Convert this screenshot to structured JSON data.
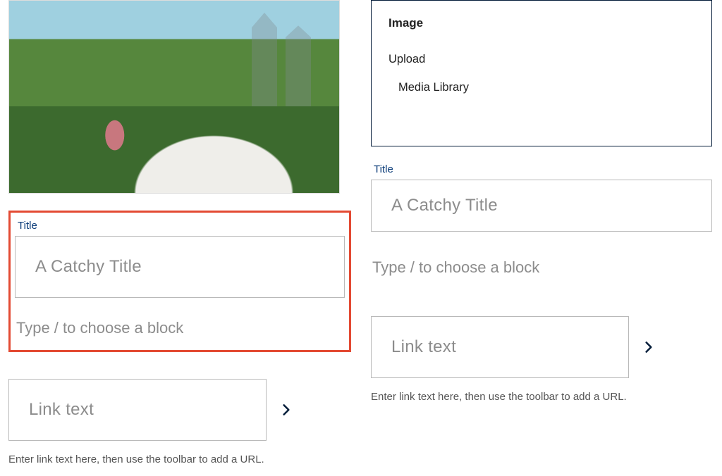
{
  "left": {
    "title_label": "Title",
    "title_placeholder": "A Catchy Title",
    "block_hint": "Type / to choose a block",
    "link_placeholder": "Link text",
    "link_helper": "Enter link text here, then use the toolbar to add a URL."
  },
  "right": {
    "image_block": {
      "heading": "Image",
      "option_upload": "Upload",
      "option_media_library": "Media Library"
    },
    "title_label": "Title",
    "title_placeholder": "A Catchy Title",
    "block_hint": "Type / to choose a block",
    "link_placeholder": "Link text",
    "link_helper": "Enter link text here, then use the toolbar to add a URL."
  }
}
